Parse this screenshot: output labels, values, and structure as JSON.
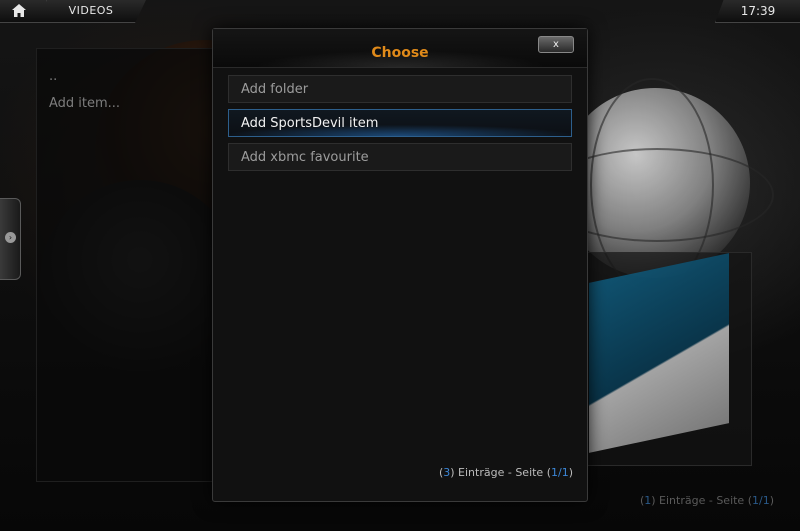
{
  "topbar": {
    "home_icon": "home-icon",
    "title": "VIDEOS",
    "clock": "17:39"
  },
  "side_panel": {
    "parent_item": "..",
    "add_item": "Add item..."
  },
  "background_footer": {
    "count": "1",
    "entries_text": "Einträge - Seite",
    "page": "1/1"
  },
  "dialog": {
    "title": "Choose",
    "close_label": "x",
    "options": [
      {
        "label": "Add folder",
        "selected": false
      },
      {
        "label": "Add SportsDevil item",
        "selected": true
      },
      {
        "label": "Add xbmc favourite",
        "selected": false
      }
    ],
    "footer": {
      "count": "3",
      "entries_text": "Einträge - Seite",
      "page": "1/1"
    }
  },
  "colors": {
    "accent_title": "#e08a1a",
    "selection_blue": "#2d5f8c",
    "footer_number": "#3b86d6"
  }
}
